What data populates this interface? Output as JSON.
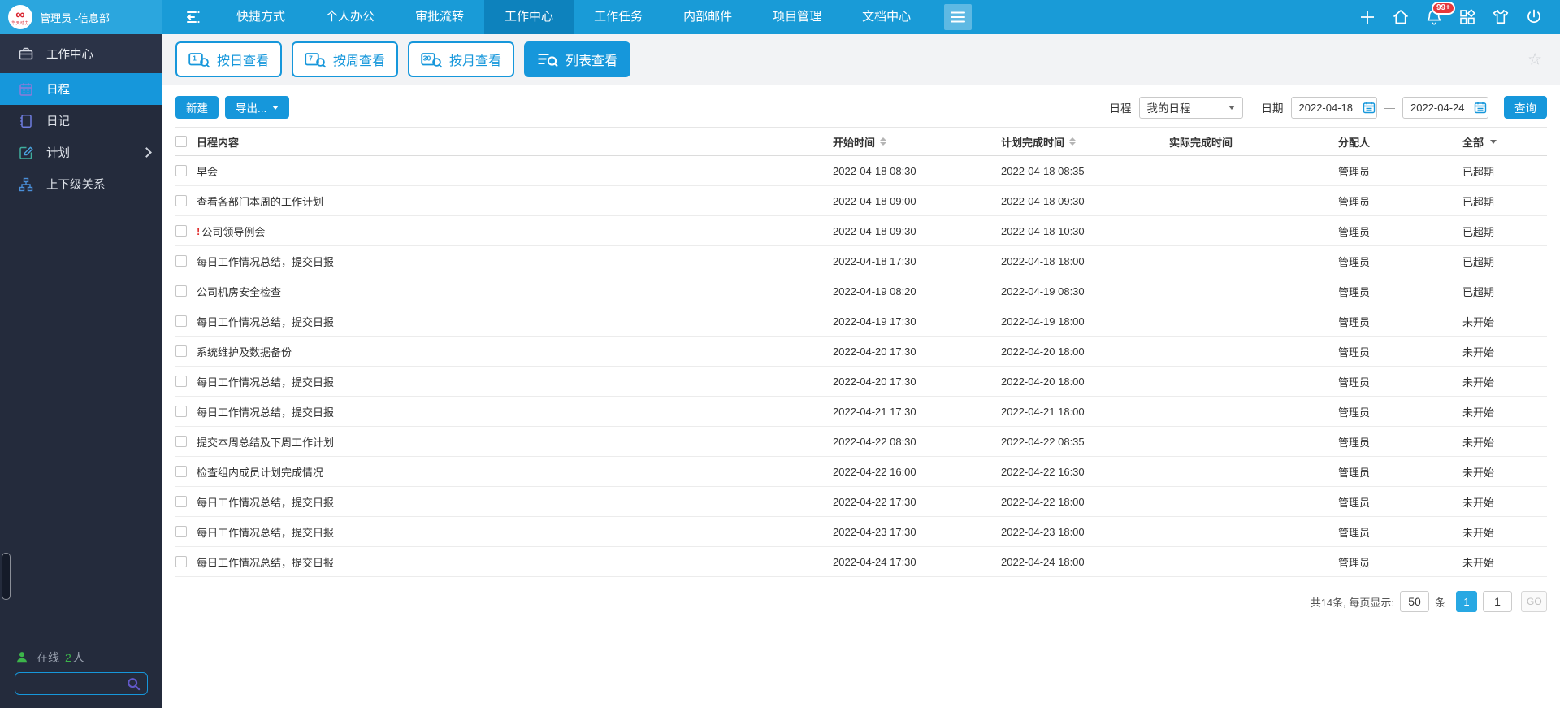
{
  "colors": {
    "accent": "#1697db",
    "topbar": "#199bd7",
    "topbar_active": "#0d82bd",
    "topbar_brand": "#2ba6de",
    "sidebar": "#242b3c",
    "sidebar_active": "#1697db",
    "badge_red": "#e5383b",
    "online_green": "#3cb54a",
    "urgent_red": "#e03131"
  },
  "topbar": {
    "logo": {
      "symbol": "∞",
      "caption": "华天动力"
    },
    "user": "管理员 -信息部",
    "menu": [
      "快捷方式",
      "个人办公",
      "审批流转",
      "工作中心",
      "工作任务",
      "内部邮件",
      "项目管理",
      "文档中心"
    ],
    "active_menu": "工作中心",
    "notification_badge": "99+",
    "right_icons": [
      "plus-icon",
      "home-icon",
      "bell-icon",
      "apps-icon",
      "shirt-icon",
      "power-icon"
    ]
  },
  "sidebar": {
    "header": {
      "label": "工作中心",
      "icon": "briefcase-icon",
      "key": "workcenter"
    },
    "items": [
      {
        "key": "schedule",
        "label": "日程",
        "icon": "calendar-icon",
        "active": true
      },
      {
        "key": "diary",
        "label": "日记",
        "icon": "diary-icon",
        "active": false
      },
      {
        "key": "plan",
        "label": "计划",
        "icon": "plan-icon",
        "active": false,
        "expandable": true
      },
      {
        "key": "hierarchy",
        "label": "上下级关系",
        "icon": "hierarchy-icon",
        "active": false
      }
    ],
    "online": {
      "icon": "person-icon",
      "prefix": "在线",
      "count": "2",
      "suffix": "人"
    },
    "search_placeholder": ""
  },
  "toolbar": {
    "views": [
      {
        "key": "day",
        "label": "按日查看",
        "icon": "calendar-day-search-icon",
        "badge": "1",
        "active": false
      },
      {
        "key": "week",
        "label": "按周查看",
        "icon": "calendar-week-search-icon",
        "badge": "7",
        "active": false
      },
      {
        "key": "month",
        "label": "按月查看",
        "icon": "calendar-month-search-icon",
        "badge": "30",
        "active": false
      },
      {
        "key": "list",
        "label": "列表查看",
        "icon": "list-search-icon",
        "badge": "",
        "active": true
      }
    ],
    "star_glyph": "☆"
  },
  "actions": {
    "new_label": "新建",
    "export_label": "导出...",
    "query_label": "查询"
  },
  "filters": {
    "schedule_label": "日程",
    "schedule_value": "我的日程",
    "date_label": "日期",
    "date_from": "2022-04-18",
    "date_to": "2022-04-24",
    "range_separator": "—"
  },
  "table": {
    "columns": [
      {
        "label": "日程内容",
        "sortable": false,
        "dropdown": false
      },
      {
        "label": "开始时间",
        "sortable": true,
        "dropdown": false
      },
      {
        "label": "计划完成时间",
        "sortable": true,
        "dropdown": false
      },
      {
        "label": "实际完成时间",
        "sortable": false,
        "dropdown": false
      },
      {
        "label": "分配人",
        "sortable": false,
        "dropdown": false
      },
      {
        "label": "全部",
        "sortable": false,
        "dropdown": true
      }
    ],
    "rows": [
      {
        "content": "早会",
        "urgent": false,
        "start": "2022-04-18 08:30",
        "plan_end": "2022-04-18 08:35",
        "actual_end": "",
        "assignee": "管理员",
        "status": "已超期"
      },
      {
        "content": "查看各部门本周的工作计划",
        "urgent": false,
        "start": "2022-04-18 09:00",
        "plan_end": "2022-04-18 09:30",
        "actual_end": "",
        "assignee": "管理员",
        "status": "已超期"
      },
      {
        "content": "公司领导例会",
        "urgent": true,
        "start": "2022-04-18 09:30",
        "plan_end": "2022-04-18 10:30",
        "actual_end": "",
        "assignee": "管理员",
        "status": "已超期"
      },
      {
        "content": "每日工作情况总结，提交日报",
        "urgent": false,
        "start": "2022-04-18 17:30",
        "plan_end": "2022-04-18 18:00",
        "actual_end": "",
        "assignee": "管理员",
        "status": "已超期"
      },
      {
        "content": "公司机房安全检查",
        "urgent": false,
        "start": "2022-04-19 08:20",
        "plan_end": "2022-04-19 08:30",
        "actual_end": "",
        "assignee": "管理员",
        "status": "已超期"
      },
      {
        "content": "每日工作情况总结，提交日报",
        "urgent": false,
        "start": "2022-04-19 17:30",
        "plan_end": "2022-04-19 18:00",
        "actual_end": "",
        "assignee": "管理员",
        "status": "未开始"
      },
      {
        "content": "系统维护及数据备份",
        "urgent": false,
        "start": "2022-04-20 17:30",
        "plan_end": "2022-04-20 18:00",
        "actual_end": "",
        "assignee": "管理员",
        "status": "未开始"
      },
      {
        "content": "每日工作情况总结，提交日报",
        "urgent": false,
        "start": "2022-04-20 17:30",
        "plan_end": "2022-04-20 18:00",
        "actual_end": "",
        "assignee": "管理员",
        "status": "未开始"
      },
      {
        "content": "每日工作情况总结，提交日报",
        "urgent": false,
        "start": "2022-04-21 17:30",
        "plan_end": "2022-04-21 18:00",
        "actual_end": "",
        "assignee": "管理员",
        "status": "未开始"
      },
      {
        "content": "提交本周总结及下周工作计划",
        "urgent": false,
        "start": "2022-04-22 08:30",
        "plan_end": "2022-04-22 08:35",
        "actual_end": "",
        "assignee": "管理员",
        "status": "未开始"
      },
      {
        "content": "检查组内成员计划完成情况",
        "urgent": false,
        "start": "2022-04-22 16:00",
        "plan_end": "2022-04-22 16:30",
        "actual_end": "",
        "assignee": "管理员",
        "status": "未开始"
      },
      {
        "content": "每日工作情况总结，提交日报",
        "urgent": false,
        "start": "2022-04-22 17:30",
        "plan_end": "2022-04-22 18:00",
        "actual_end": "",
        "assignee": "管理员",
        "status": "未开始"
      },
      {
        "content": "每日工作情况总结，提交日报",
        "urgent": false,
        "start": "2022-04-23 17:30",
        "plan_end": "2022-04-23 18:00",
        "actual_end": "",
        "assignee": "管理员",
        "status": "未开始"
      },
      {
        "content": "每日工作情况总结，提交日报",
        "urgent": false,
        "start": "2022-04-24 17:30",
        "plan_end": "2022-04-24 18:00",
        "actual_end": "",
        "assignee": "管理员",
        "status": "未开始"
      }
    ]
  },
  "pagination": {
    "summary": "共14条, 每页显示:",
    "page_size": "50",
    "unit": "条",
    "current_page": "1",
    "goto_value": "1",
    "go_label": "GO"
  }
}
